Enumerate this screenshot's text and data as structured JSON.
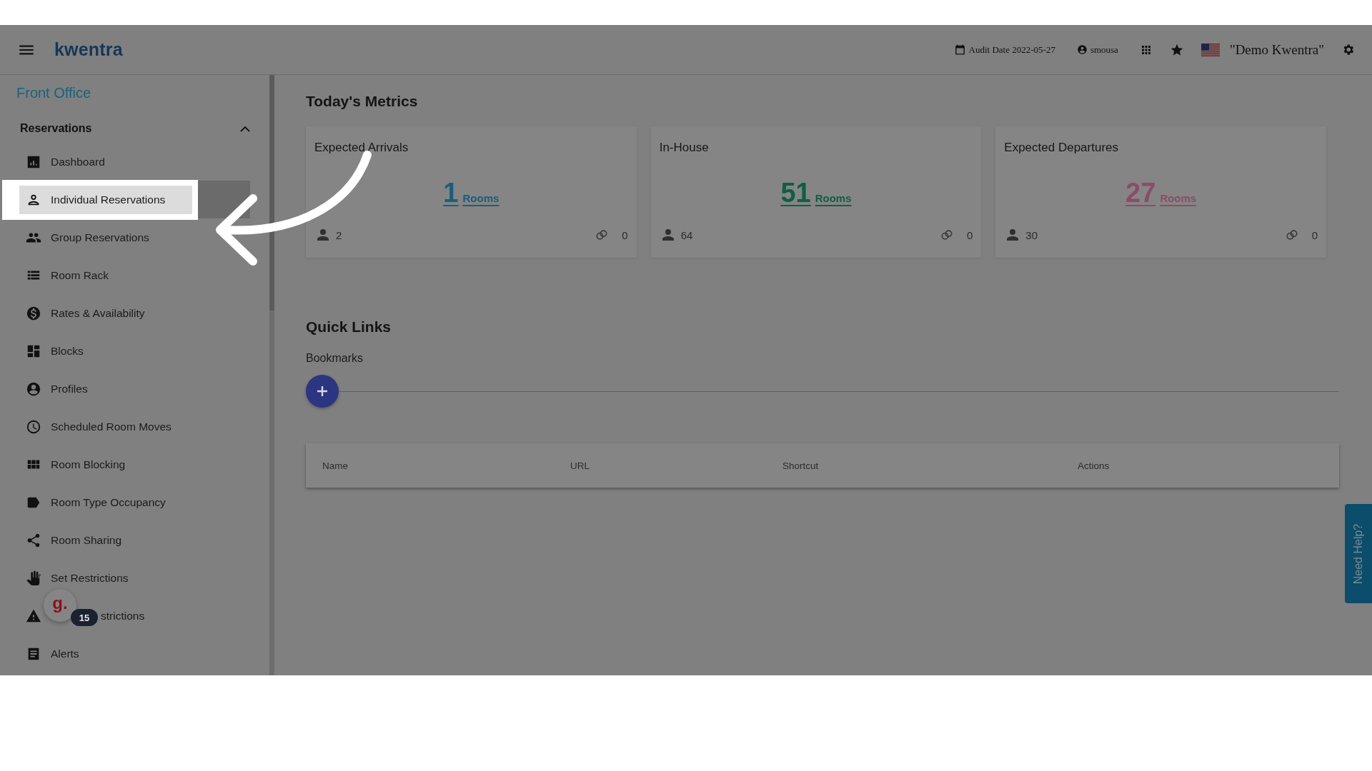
{
  "header": {
    "logo": "kwentra",
    "audit_date": "Audit Date 2022-05-27",
    "user": "smousa",
    "property": "\"Demo Kwentra\""
  },
  "sidebar": {
    "module": "Front Office",
    "section": {
      "title": "Reservations",
      "expanded": true
    },
    "items": [
      {
        "label": "Dashboard",
        "selected": false
      },
      {
        "label": "Individual Reservations",
        "selected": true
      },
      {
        "label": "Group Reservations",
        "selected": false
      },
      {
        "label": "Room Rack",
        "selected": false
      },
      {
        "label": "Rates & Availability",
        "selected": false
      },
      {
        "label": "Blocks",
        "selected": false
      },
      {
        "label": "Profiles",
        "selected": false
      },
      {
        "label": "Scheduled Room Moves",
        "selected": false
      },
      {
        "label": "Room Blocking",
        "selected": false
      },
      {
        "label": "Room Type Occupancy",
        "selected": false
      },
      {
        "label": "Room Sharing",
        "selected": false
      },
      {
        "label": "Set Restrictions",
        "selected": false
      },
      {
        "label": "strictions",
        "selected": false,
        "obscured": true
      },
      {
        "label": "Alerts",
        "selected": false
      }
    ]
  },
  "metrics": {
    "title": "Today's Metrics",
    "cards": [
      {
        "title": "Expected Arrivals",
        "count": "1",
        "unit": "Rooms",
        "color": "#1b5d7c",
        "guests": "2",
        "links": "0"
      },
      {
        "title": "In-House",
        "count": "51",
        "unit": "Rooms",
        "color": "#0e5f45",
        "guests": "64",
        "links": "0"
      },
      {
        "title": "Expected Departures",
        "count": "27",
        "unit": "Rooms",
        "color": "#8a4c69",
        "guests": "30",
        "links": "0"
      }
    ]
  },
  "quick_links": {
    "title": "Quick Links",
    "subtitle": "Bookmarks",
    "columns": [
      "Name",
      "URL",
      "Shortcut",
      "Actions"
    ]
  },
  "help_tab": "Need Help?",
  "chat_widget": {
    "logo": "g.",
    "badge": "15"
  }
}
